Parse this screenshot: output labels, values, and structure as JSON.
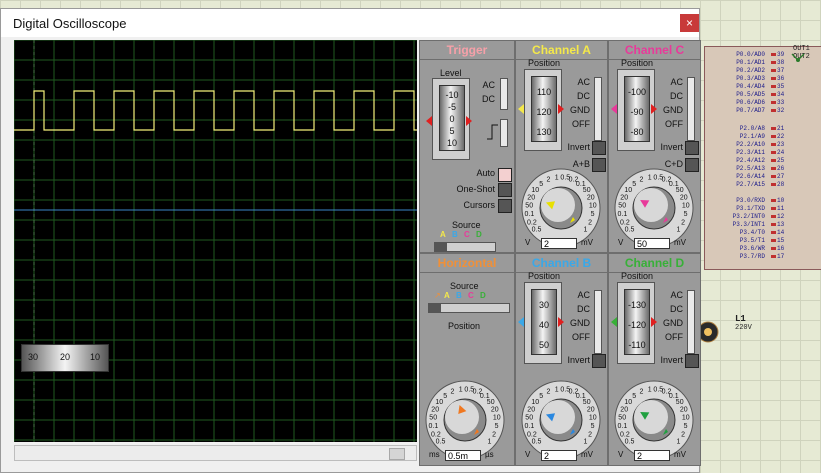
{
  "window": {
    "title": "Digital Oscilloscope",
    "close_glyph": "×"
  },
  "scope": {
    "grid_color": "#1f5a1f",
    "trace_a_color": "#f4f07a",
    "trace_c_color": "#3a86c8",
    "trace_a_levels": [
      "high",
      "low"
    ],
    "trace_a_pulse_count": 11
  },
  "trigger": {
    "title": "Trigger",
    "title_color": "#f6a0a8",
    "level_label": "Level",
    "drum_ticks": [
      "-10",
      "-5",
      "0",
      "5",
      "10"
    ],
    "coupling": [
      "AC",
      "DC"
    ],
    "modes": [
      "Auto",
      "One-Shot",
      "Cursors"
    ],
    "source_label": "Source",
    "source_letters": [
      "A",
      "B",
      "C",
      "D"
    ],
    "source_colors": [
      "#f4e84a",
      "#3aa8e8",
      "#e83a9a",
      "#38b038"
    ]
  },
  "channel_a": {
    "title": "Channel A",
    "title_color": "#f4e84a",
    "position_label": "Position",
    "drum_ticks": [
      "110",
      "120",
      "130"
    ],
    "coupling": [
      "AC",
      "DC",
      "GND",
      "OFF"
    ],
    "invert": "Invert",
    "combine": "A+B",
    "dial_ticks": [
      "0.5",
      "0.2",
      "0.1",
      "50",
      "20",
      "10",
      "5",
      "2",
      "1",
      "0.5",
      "0.2",
      "0.1",
      "50",
      "20",
      "10",
      "5",
      "2",
      "1"
    ],
    "volts": "2",
    "unit_left": "V",
    "unit_right": "mV"
  },
  "channel_c": {
    "title": "Channel C",
    "title_color": "#e83a9a",
    "position_label": "Position",
    "drum_ticks": [
      "-100",
      "-90",
      "-80"
    ],
    "coupling": [
      "AC",
      "DC",
      "GND",
      "OFF"
    ],
    "invert": "Invert",
    "combine": "C+D",
    "dial_ticks": [
      "0.5",
      "0.2",
      "0.1",
      "50",
      "20",
      "10",
      "5",
      "2",
      "1",
      "0.5",
      "0.2",
      "0.1",
      "50",
      "20",
      "10",
      "5",
      "2",
      "1"
    ],
    "volts": "50",
    "unit_left": "V",
    "unit_right": "mV"
  },
  "horizontal": {
    "title": "Horizontal",
    "title_color": "#f09038",
    "source_label": "Source",
    "position_label": "Position",
    "position_ticks": [
      "30",
      "20",
      "10"
    ],
    "dial_ticks": [
      "0.5",
      "0.2",
      "0.1",
      "50",
      "20",
      "10",
      "5",
      "2",
      "1",
      "0.5",
      "0.2",
      "0.1",
      "50",
      "20",
      "10",
      "5",
      "2",
      "1",
      "200",
      "100",
      "50",
      "20",
      "10"
    ],
    "time": "0.5m",
    "unit_left": "ms",
    "unit_right": "µs"
  },
  "channel_b": {
    "title": "Channel B",
    "title_color": "#3aa8e8",
    "position_label": "Position",
    "drum_ticks": [
      "30",
      "40",
      "50"
    ],
    "coupling": [
      "AC",
      "DC",
      "GND",
      "OFF"
    ],
    "invert": "Invert",
    "dial_ticks": [
      "0.5",
      "0.2",
      "0.1",
      "50",
      "20",
      "10",
      "5",
      "2",
      "1",
      "0.5",
      "0.2",
      "0.1",
      "50",
      "20",
      "10",
      "5",
      "2",
      "1"
    ],
    "volts": "2",
    "unit_left": "V",
    "unit_right": "mV"
  },
  "channel_d": {
    "title": "Channel D",
    "title_color": "#38b038",
    "position_label": "Position",
    "drum_ticks": [
      "-130",
      "-120",
      "-110"
    ],
    "coupling": [
      "AC",
      "DC",
      "GND",
      "OFF"
    ],
    "invert": "Invert",
    "dial_ticks": [
      "0.5",
      "0.2",
      "0.1",
      "50",
      "20",
      "10",
      "5",
      "2",
      "1",
      "0.5",
      "0.2",
      "0.1",
      "50",
      "20",
      "10",
      "5",
      "2",
      "1"
    ],
    "volts": "2",
    "unit_left": "V",
    "unit_right": "mV"
  },
  "chip": {
    "pins_top": [
      {
        "name": "P0.0/AD0",
        "num": "39"
      },
      {
        "name": "P0.1/AD1",
        "num": "38"
      },
      {
        "name": "P0.2/AD2",
        "num": "37"
      },
      {
        "name": "P0.3/AD3",
        "num": "36"
      },
      {
        "name": "P0.4/AD4",
        "num": "35"
      },
      {
        "name": "P0.5/AD5",
        "num": "34"
      },
      {
        "name": "P0.6/AD6",
        "num": "33"
      },
      {
        "name": "P0.7/AD7",
        "num": "32"
      }
    ],
    "pins_mid": [
      {
        "name": "P2.0/A8",
        "num": "21"
      },
      {
        "name": "P2.1/A9",
        "num": "22"
      },
      {
        "name": "P2.2/A10",
        "num": "23"
      },
      {
        "name": "P2.3/A11",
        "num": "24"
      },
      {
        "name": "P2.4/A12",
        "num": "25"
      },
      {
        "name": "P2.5/A13",
        "num": "26"
      },
      {
        "name": "P2.6/A14",
        "num": "27"
      },
      {
        "name": "P2.7/A15",
        "num": "28"
      }
    ],
    "pins_bot": [
      {
        "name": "P3.0/RXD",
        "num": "10"
      },
      {
        "name": "P3.1/TXD",
        "num": "11"
      },
      {
        "name": "P3.2/INT0",
        "num": "12"
      },
      {
        "name": "P3.3/INT1",
        "num": "13"
      },
      {
        "name": "P3.4/T0",
        "num": "14"
      },
      {
        "name": "P3.5/T1",
        "num": "15"
      },
      {
        "name": "P3.6/WR",
        "num": "16"
      },
      {
        "name": "P3.7/RD",
        "num": "17"
      }
    ],
    "out1": "OUT1",
    "out2": "OUT2",
    "lamp_name": "L1",
    "lamp_voltage": "220V"
  }
}
